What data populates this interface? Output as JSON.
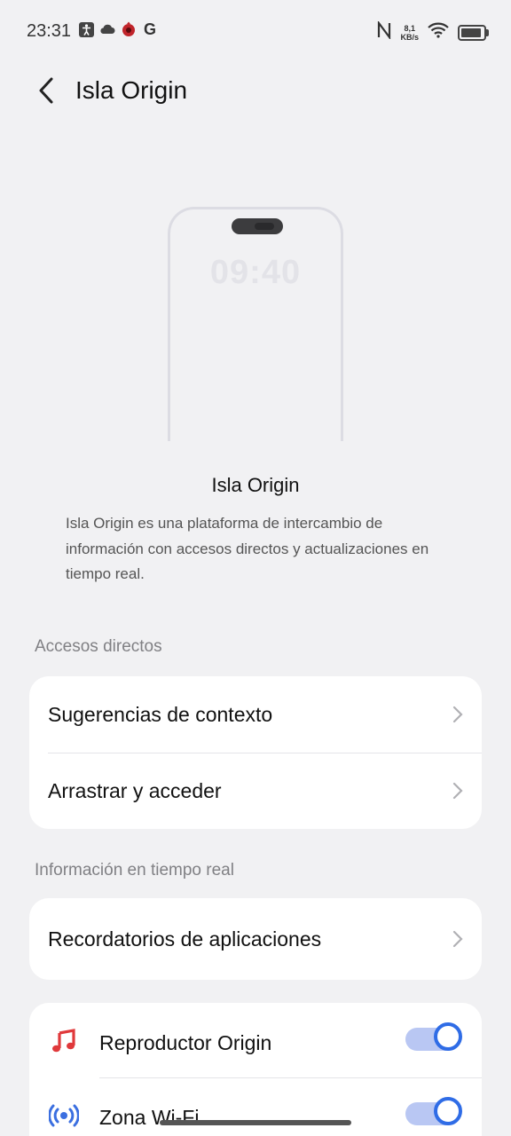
{
  "status_bar": {
    "time": "23:31",
    "left_icons": [
      "accessibility-icon",
      "cloud-icon",
      "app-notification-icon",
      "google-icon"
    ],
    "google_letter": "G",
    "net_speed_value": "8,1",
    "net_speed_unit": "KB/s",
    "battery_level": 0.9
  },
  "header": {
    "title": "Isla Origin"
  },
  "illustration": {
    "clock": "09:40"
  },
  "feature": {
    "title": "Isla Origin",
    "description": "Isla Origin es una plataforma de intercambio de información con accesos directos y actualizaciones en tiempo real."
  },
  "sections": {
    "shortcuts_label": "Accesos directos",
    "shortcuts": [
      {
        "label": "Sugerencias de contexto"
      },
      {
        "label": "Arrastrar y acceder"
      }
    ],
    "realtime_label": "Información en tiempo real",
    "realtime": [
      {
        "label": "Recordatorios de aplicaciones"
      }
    ],
    "apps": [
      {
        "label": "Reproductor Origin",
        "icon": "music-note-icon",
        "enabled": true
      },
      {
        "label": "Zona Wi-Fi",
        "icon": "hotspot-icon",
        "enabled": true
      }
    ]
  },
  "colors": {
    "accent": "#2f6ce6",
    "toggle_track": "#b9c7f3",
    "music_icon": "#e0393b",
    "hotspot_icon": "#3b6fe0",
    "background": "#f1f1f3"
  }
}
